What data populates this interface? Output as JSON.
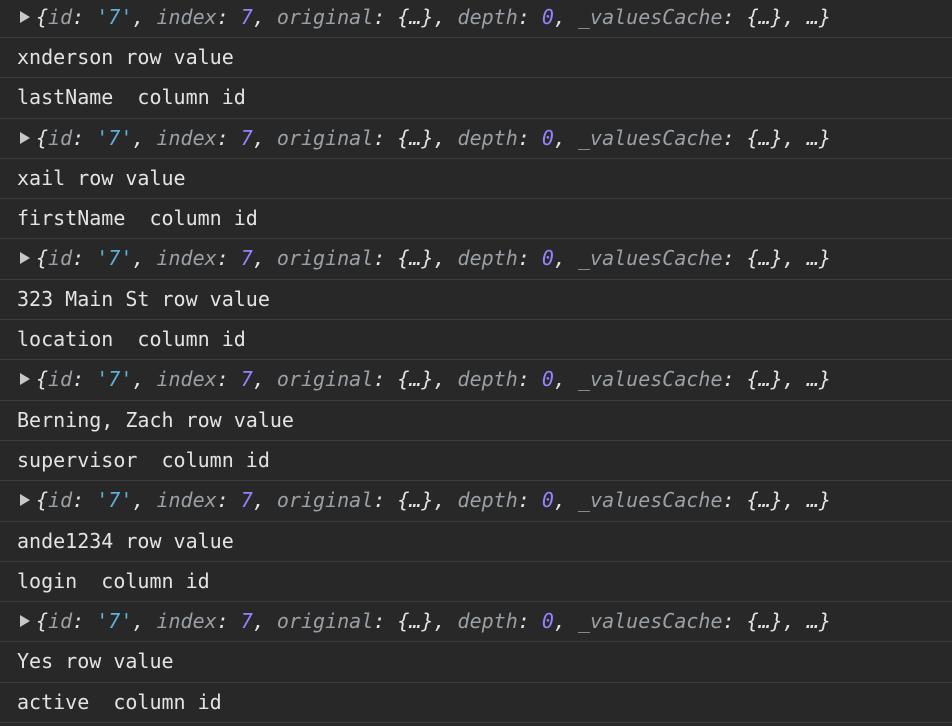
{
  "object_preview": {
    "open": "{",
    "key_id": "id",
    "val_id": "'7'",
    "key_index": "index",
    "val_index": "7",
    "key_original": "original",
    "val_original": "{…}",
    "key_depth": "depth",
    "val_depth": "0",
    "key_cache": "_valuesCache",
    "val_cache": "{…}",
    "tail": "…}"
  },
  "log_pairs": [
    {
      "row_value": "xnderson row value",
      "column_id": "lastName  column id"
    },
    {
      "row_value": "xail row value",
      "column_id": "firstName  column id"
    },
    {
      "row_value": "323 Main St row value",
      "column_id": "location  column id"
    },
    {
      "row_value": "Berning, Zach row value",
      "column_id": "supervisor  column id"
    },
    {
      "row_value": "ande1234 row value",
      "column_id": "login  column id"
    },
    {
      "row_value": "Yes row value",
      "column_id": "active  column id"
    }
  ],
  "colors": {
    "background": "#282828",
    "divider": "#3d3d3d",
    "text": "#e3e3e3",
    "key": "#9aa0a6",
    "string": "#5db0d7",
    "number": "#9980ff"
  }
}
